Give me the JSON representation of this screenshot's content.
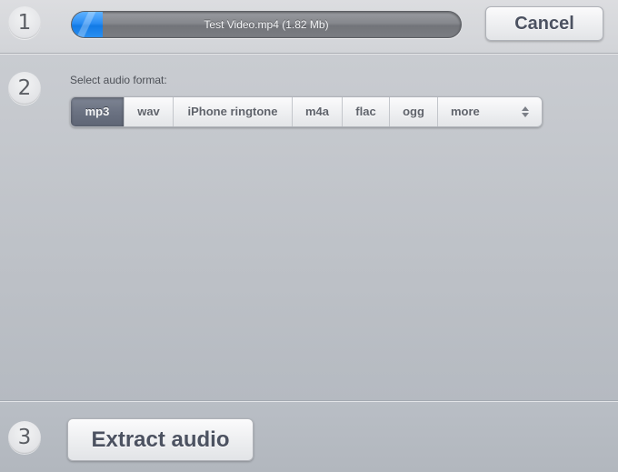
{
  "step1": {
    "number": "1",
    "progress": {
      "label": "Test Video.mp4 (1.82 Mb)",
      "fraction": 0.08,
      "fill_color": "#1f86ee"
    },
    "cancel_label": "Cancel"
  },
  "step2": {
    "number": "2",
    "label": "Select audio format:",
    "formats": [
      {
        "label": "mp3",
        "selected": true
      },
      {
        "label": "wav",
        "selected": false
      },
      {
        "label": "iPhone ringtone",
        "selected": false
      },
      {
        "label": "m4a",
        "selected": false
      },
      {
        "label": "flac",
        "selected": false
      },
      {
        "label": "ogg",
        "selected": false
      }
    ],
    "more_label": "more",
    "more_icon": "up-down-arrows-icon"
  },
  "step3": {
    "number": "3",
    "extract_label": "Extract audio"
  }
}
